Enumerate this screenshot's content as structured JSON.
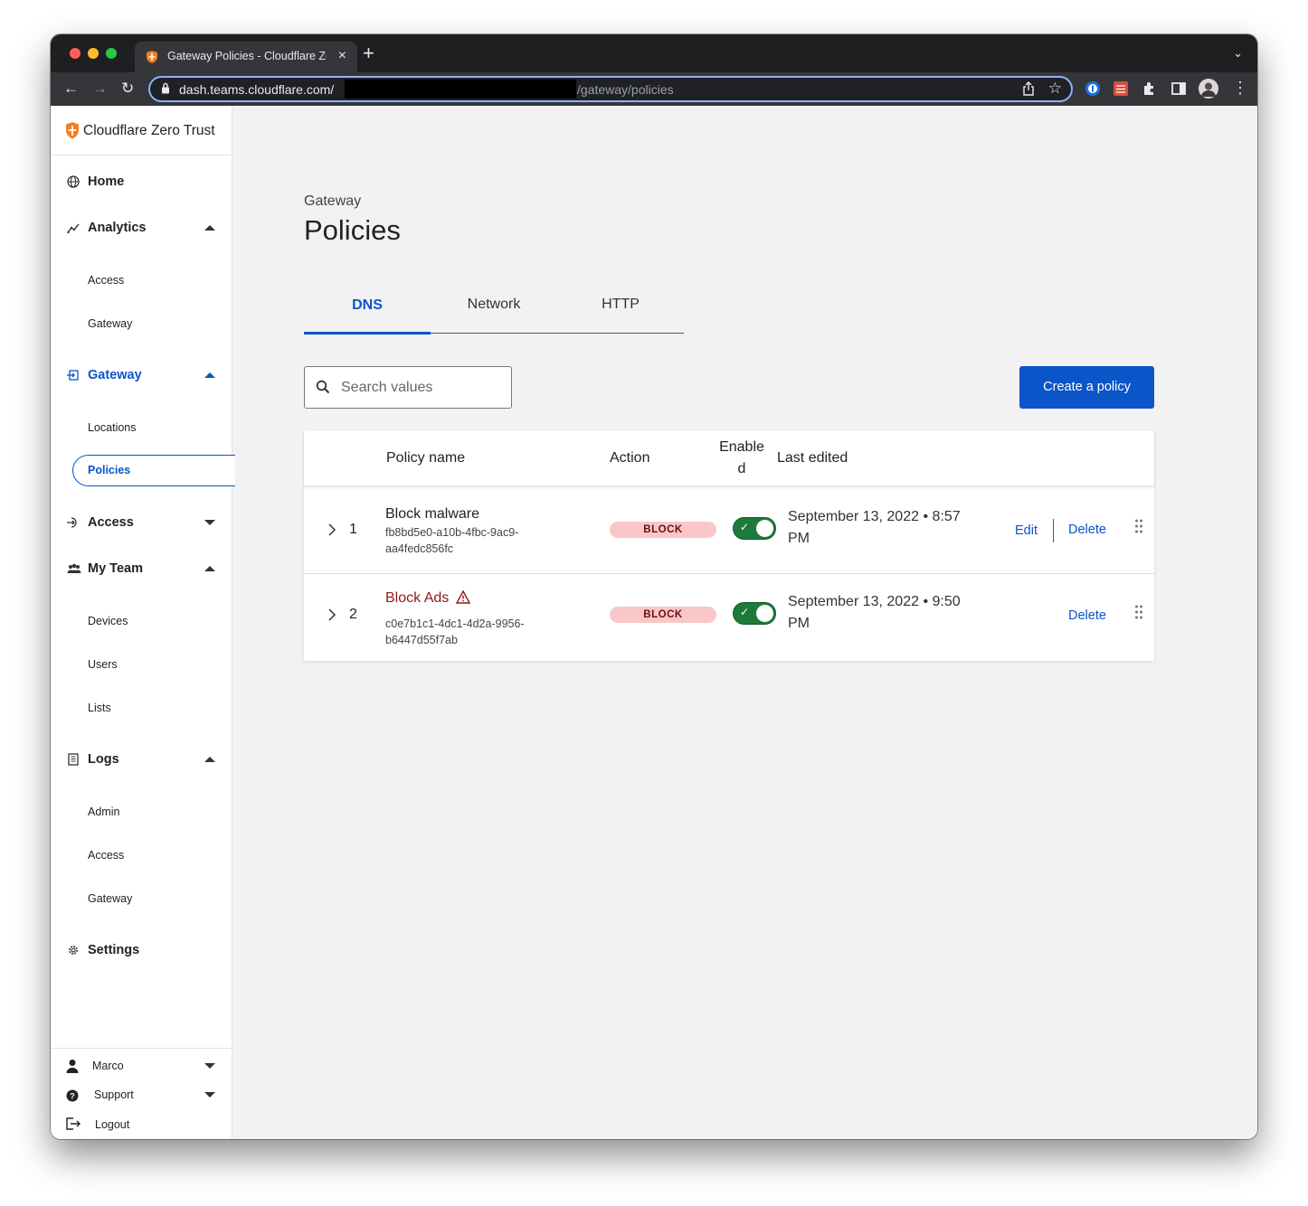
{
  "browser": {
    "tab_title": "Gateway Policies - Cloudflare Zero Trust",
    "url_host": "dash.teams.cloudflare.com/",
    "url_path": "/gateway/policies",
    "colors": {
      "chrome_dark": "#1f1f22",
      "chrome_toolbar": "#35363a",
      "omnibox_focus": "#8ab4f8"
    }
  },
  "brand": {
    "name": "Cloudflare Zero Trust",
    "logo_color": "#f38020"
  },
  "sidebar": {
    "sections": [
      {
        "label": "Home",
        "icon": "globe-icon",
        "expandable": false
      },
      {
        "label": "Analytics",
        "icon": "analytics-icon",
        "expanded": true,
        "items": [
          "Access",
          "Gateway"
        ]
      },
      {
        "label": "Gateway",
        "icon": "gateway-icon",
        "expanded": true,
        "active": true,
        "items": [
          "Locations",
          "Policies"
        ],
        "selected_item": "Policies"
      },
      {
        "label": "Access",
        "icon": "access-icon",
        "expanded": false
      },
      {
        "label": "My Team",
        "icon": "team-icon",
        "expanded": true,
        "items": [
          "Devices",
          "Users",
          "Lists"
        ]
      },
      {
        "label": "Logs",
        "icon": "logs-icon",
        "expanded": true,
        "items": [
          "Admin",
          "Access",
          "Gateway"
        ]
      },
      {
        "label": "Settings",
        "icon": "gear-icon",
        "expandable": false
      }
    ],
    "footer": {
      "user": "Marco",
      "support": "Support",
      "logout": "Logout"
    }
  },
  "page": {
    "breadcrumb": "Gateway",
    "title": "Policies",
    "tabs": [
      "DNS",
      "Network",
      "HTTP"
    ],
    "active_tab": "DNS",
    "search_placeholder": "Search values",
    "create_button": "Create a policy",
    "accent_color": "#0a55c8"
  },
  "table": {
    "columns": {
      "name": "Policy name",
      "action": "Action",
      "enabled": "Enable d",
      "last_edited": "Last edited"
    },
    "rows": [
      {
        "precedence": "1",
        "name": "Block malware",
        "id": "fb8bd5e0-a10b-4fbc-9ac9-aa4fedc856fc",
        "action": "BLOCK",
        "enabled": true,
        "last_edited": "September 13, 2022 • 8:57 PM",
        "edit_label": "Edit",
        "delete_label": "Delete"
      },
      {
        "precedence": "2",
        "name": "Block Ads",
        "warning": true,
        "id": "c0e7b1c1-4dc1-4d2a-9956-b6447d55f7ab",
        "action": "BLOCK",
        "enabled": true,
        "last_edited": "September 13, 2022 • 9:50 PM",
        "delete_label": "Delete"
      }
    ],
    "colors": {
      "block_badge_bg": "#f9c7c7",
      "block_badge_text": "#6b0f0f",
      "toggle_on": "#1d7a3a",
      "warning_text": "#8b1a1a"
    }
  }
}
